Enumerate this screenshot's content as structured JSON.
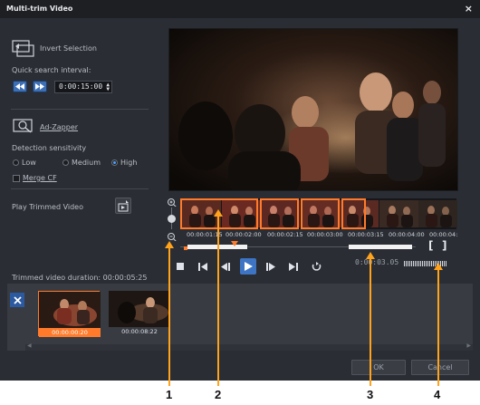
{
  "window": {
    "title": "Multi-trim Video",
    "close_glyph": "×"
  },
  "left": {
    "invert_selection": "Invert Selection",
    "quick_search_label": "Quick search interval:",
    "interval_value": "0:00:15:00",
    "ad_zapper": "Ad-Zapper",
    "detection_label": "Detection sensitivity",
    "options": [
      "Low",
      "Medium",
      "High"
    ],
    "selected_option": "High",
    "merge_cf": "Merge CF",
    "play_trimmed": "Play Trimmed Video"
  },
  "timeline": {
    "ticks": [
      "00:00:01:15",
      "00:00:02:00",
      "00:00:02:15",
      "00:00:03:00",
      "00:00:03:15",
      "00:00:04:00",
      "00:00:04:"
    ],
    "timecode": "0:00:03.05",
    "bracket_in": "[",
    "bracket_out": "]"
  },
  "clips": {
    "duration_label": "Trimmed video duration: 00:00:05:25",
    "items": [
      {
        "caption": "00:00:00:20",
        "selected": true
      },
      {
        "caption": "00:00:08:22",
        "selected": false
      }
    ]
  },
  "footer": {
    "ok": "OK",
    "cancel": "Cancel"
  },
  "callouts": [
    "1",
    "2",
    "3",
    "4"
  ],
  "icons": {
    "invert": "invert-selection-icon",
    "rewind": "rewind-icon",
    "forward": "fast-forward-icon",
    "ad_zapper": "ad-zapper-icon",
    "play_trimmed": "play-trimmed-icon",
    "zoom_in": "zoom-in-icon",
    "zoom_out": "zoom-out-icon",
    "delete_clip": "delete-clip-icon"
  },
  "colors": {
    "accent": "#ff7a2a",
    "callout": "#ffa21c",
    "play": "#3d74c4"
  }
}
